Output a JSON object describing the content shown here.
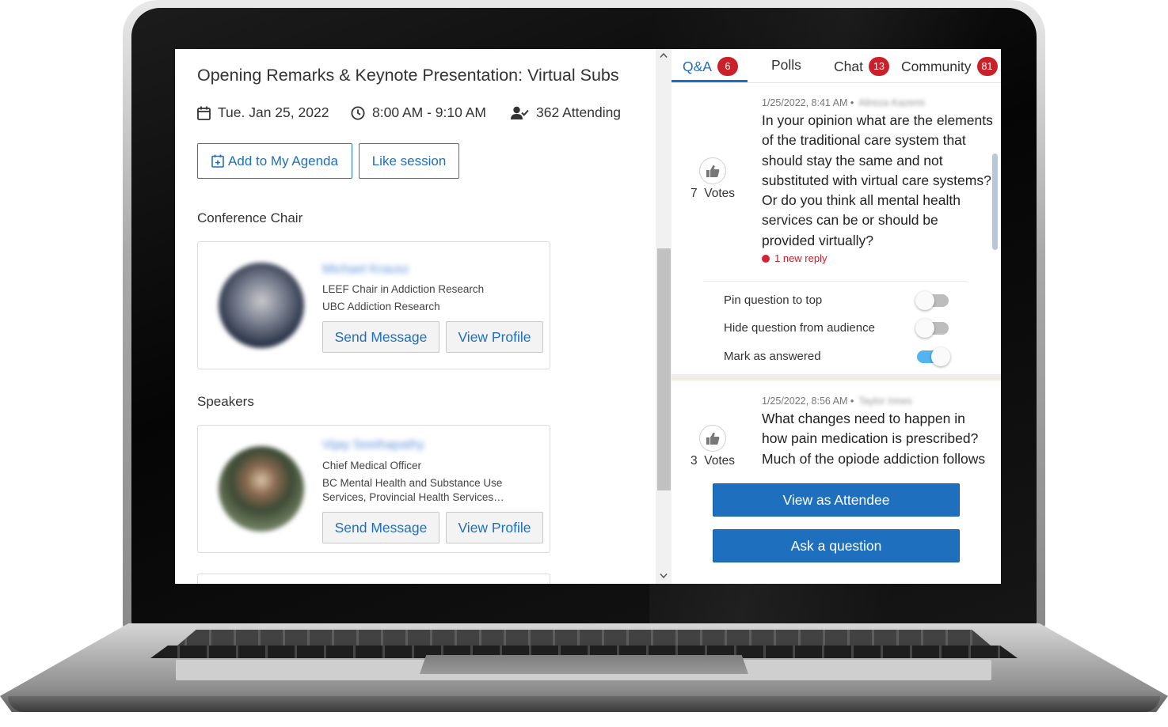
{
  "session": {
    "title": "Opening Remarks & Keynote Presentation: Virtual Subs",
    "date": "Tue. Jan 25, 2022",
    "time": "8:00 AM - 9:10 AM",
    "attending": "362 Attending",
    "add_agenda_label": "Add to My Agenda",
    "like_label": "Like session"
  },
  "sections": {
    "chair_label": "Conference Chair",
    "speakers_label": "Speakers"
  },
  "people": [
    {
      "name": "Michael Krausz",
      "role_line1": "LEEF Chair in Addiction Research",
      "role_line2": "UBC Addiction Research",
      "send_label": "Send Message",
      "profile_label": "View Profile"
    },
    {
      "name": "Vijay Seethapathy",
      "role_line1": "Chief Medical Officer",
      "role_line2": "BC Mental Health and Substance Use",
      "role_line3": "Services, Provincial Health Services…",
      "send_label": "Send Message",
      "profile_label": "View Profile"
    }
  ],
  "tabs": [
    {
      "label": "Q&A",
      "badge": "6"
    },
    {
      "label": "Polls",
      "badge": ""
    },
    {
      "label": "Chat",
      "badge": "13"
    },
    {
      "label": "Community",
      "badge": "81"
    }
  ],
  "questions": [
    {
      "time": "1/25/2022, 8:41 AM •",
      "author": "Alireza Kazemi",
      "votes_count": "7",
      "votes_label": "Votes",
      "text": "In your opinion what are the elements of the traditional care system that should stay the same and not substituted with virtual care systems? Or do you think all mental health services can be or should be provided virtually?",
      "new_reply": "1 new reply"
    },
    {
      "time": "1/25/2022, 8:56 AM •",
      "author": "Taylor Innes",
      "votes_count": "3",
      "votes_label": "Votes",
      "text": "What changes need to happen in how pain medication is prescribed? Much of the opiode addiction follows"
    }
  ],
  "moderation": {
    "pin_label": "Pin question to top",
    "pin_on": false,
    "hide_label": "Hide question from audience",
    "hide_on": false,
    "answered_label": "Mark as answered",
    "answered_on": true
  },
  "actions": {
    "view_attendee_label": "View as Attendee",
    "ask_label": "Ask a question"
  },
  "colors": {
    "accent": "#1f6fbf",
    "badge": "#c9202a",
    "toggle_on": "#53b4ee"
  }
}
